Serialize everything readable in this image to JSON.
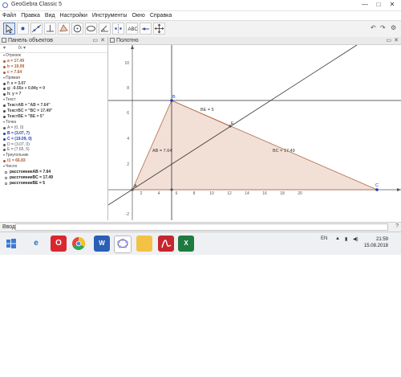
{
  "window": {
    "title": "GeoGebra Classic 5",
    "minimize": "—",
    "maximize": "□",
    "close": "✕"
  },
  "menu": [
    "Файл",
    "Правка",
    "Вид",
    "Настройки",
    "Инструменты",
    "Окно",
    "Справка"
  ],
  "toolbar": {
    "tools": [
      "move",
      "point",
      "line",
      "perpendicular",
      "polygon",
      "circle",
      "ellipse",
      "angle",
      "reflect",
      "text",
      "slider",
      "move-view"
    ],
    "undo": "↶",
    "redo": "↷",
    "settings": "⚙"
  },
  "algebra_panel": {
    "title": "Панель объектов",
    "tools_label": "fx",
    "sections": [
      {
        "category": "Отрезок",
        "items": [
          {
            "text": "a = 17.49",
            "color": "#b05a2f",
            "bold": true
          },
          {
            "text": "b = 19.09",
            "color": "#b05a2f",
            "bold": true
          },
          {
            "text": "c = 7.64",
            "color": "#b05a2f",
            "bold": true
          }
        ]
      },
      {
        "category": "Прямая",
        "items": [
          {
            "text": "f: x = 3.07",
            "color": "#444444",
            "bold": true
          },
          {
            "text": "g: -0.55x + 0.84y = 0",
            "color": "#444444",
            "bold": true
          },
          {
            "text": "h: y = 7",
            "color": "#444444",
            "bold": true
          }
        ]
      },
      {
        "category": "Текст",
        "items": [
          {
            "text": "ТекстAB = \"AB = 7.64\"",
            "color": "#444444",
            "bold": true
          },
          {
            "text": "ТекстBC = \"BC = 17.49\"",
            "color": "#444444",
            "bold": true
          },
          {
            "text": "ТекстBE = \"BE = 5\"",
            "color": "#444444",
            "bold": true
          }
        ]
      },
      {
        "category": "Точка",
        "items": [
          {
            "text": "A = (0, 0)",
            "color": "#555555",
            "bold": false
          },
          {
            "text": "B = (3.07, 7)",
            "color": "#1f3bb3",
            "bold": true
          },
          {
            "text": "C = (19.09, 0)",
            "color": "#1f3bb3",
            "bold": true
          },
          {
            "text": "D = (3.07, 0)",
            "color": "#555555",
            "bold": false
          },
          {
            "text": "E = (7.65, 5)",
            "color": "#555555",
            "bold": false
          }
        ]
      },
      {
        "category": "Треугольник",
        "items": [
          {
            "text": "t1 = 66.83",
            "color": "#b05a2f",
            "bold": true
          }
        ]
      },
      {
        "category": "Число",
        "items": [
          {
            "text": "расстояниеAB = 7.64",
            "color": "#222222",
            "bold": true,
            "checkbox": true
          },
          {
            "text": "расстояниеBC = 17.49",
            "color": "#222222",
            "bold": true,
            "checkbox": true
          },
          {
            "text": "расстояниеBE = 5",
            "color": "#222222",
            "bold": true,
            "checkbox": true
          }
        ]
      }
    ]
  },
  "graphics_panel": {
    "title": "Полотно",
    "x_ticks": [
      "2",
      "4",
      "6",
      "8",
      "10",
      "12",
      "14",
      "16",
      "18",
      "20"
    ],
    "y_ticks": [
      "10",
      "8",
      "6",
      "4",
      "2",
      "-2"
    ],
    "labels": {
      "A": "A",
      "B": "B",
      "C": "C",
      "E": "E",
      "AB": "AB = 7.64",
      "BC": "BC = 17.49",
      "BE": "BE = 5"
    },
    "colors": {
      "triangle_fill": "#e9cbbd",
      "triangle_edge": "#b06a45",
      "line": "#333333",
      "point": "#1f3bb3"
    }
  },
  "input_bar": {
    "label": "Ввод:",
    "help": "?"
  },
  "taskbar": {
    "apps": [
      "windows-start",
      "internet-explorer",
      "opera",
      "chrome",
      "word",
      "geogebra",
      "file-explorer",
      "pdf-reader",
      "excel"
    ],
    "lang": "EN",
    "time": "21:59",
    "date": "15.08.2018"
  }
}
